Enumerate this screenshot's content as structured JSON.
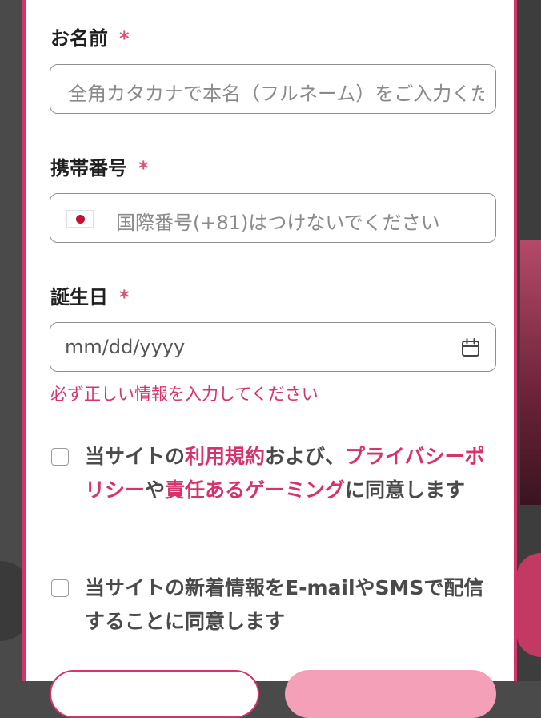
{
  "form": {
    "name_field": {
      "label": "お名前",
      "required_mark": "*",
      "placeholder": "全角カタカナで本名（フルネーム）をご入力ください"
    },
    "phone_field": {
      "label": "携帯番号",
      "required_mark": "*",
      "flag_icon": "japan-flag-icon",
      "placeholder": "国際番号(+81)はつけないでください"
    },
    "birthdate_field": {
      "label": "誕生日",
      "required_mark": "*",
      "value": "mm/dd/yyyy",
      "icon": "calendar-icon",
      "error": "必ず正しい情報を入力してください"
    },
    "terms_checkbox": {
      "checked": false,
      "text_1": "当サイトの",
      "link_terms": "利用規約",
      "text_2": "および、",
      "link_privacy": "プライバシーポリシー",
      "text_3": "や",
      "link_gaming": "責任あるゲーミング",
      "text_4": "に同意します"
    },
    "newsletter_checkbox": {
      "checked": false,
      "text": "当サイトの新着情報をE-mailやSMSで配信することに同意します"
    }
  },
  "colors": {
    "accent": "#d6336c",
    "required": "#e04f6f",
    "error": "#d6336c",
    "backdrop": "#4a4a4a"
  }
}
